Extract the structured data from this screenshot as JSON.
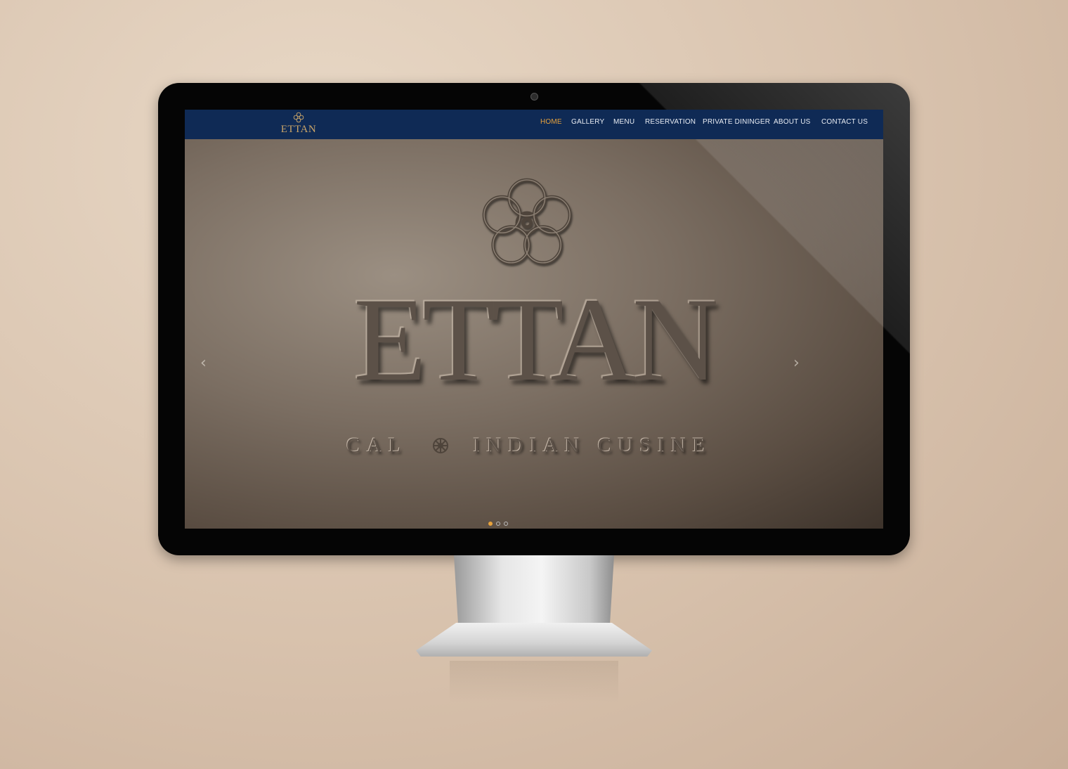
{
  "brand": {
    "logo_text": "ETTAN",
    "accent_color": "#c9a468"
  },
  "nav": {
    "background": "#0f2a55",
    "active_color": "#e8a33c",
    "items": [
      {
        "label": "HOME",
        "active": true
      },
      {
        "label": "GALLERY",
        "active": false
      },
      {
        "label": "MENU",
        "active": false
      },
      {
        "label": "RESERVATION",
        "active": false
      },
      {
        "label": "PRIVATE DININGER",
        "active": false
      },
      {
        "label": "ABOUT US",
        "active": false
      },
      {
        "label": "CONTACT US",
        "active": false
      }
    ]
  },
  "hero": {
    "title": "ETTAN",
    "subtitle_left": "CAL",
    "subtitle_right": "INDIAN CUSINE",
    "prev_arrow": "‹",
    "next_arrow": "›",
    "slides_total": 3,
    "active_slide": 1
  },
  "icons": {
    "logo": "flower-logo-icon",
    "hero": "flower-emblem-icon",
    "subtitle_separator": "flower-ornament-icon"
  }
}
